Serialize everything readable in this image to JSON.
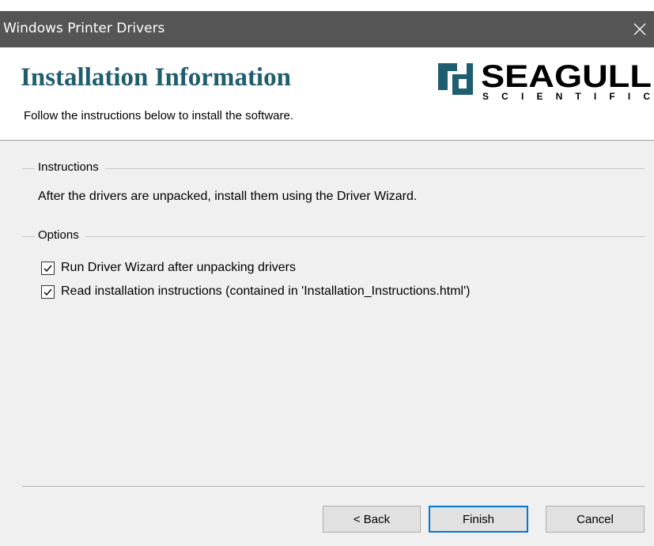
{
  "window": {
    "title": "Windows Printer Drivers",
    "close_icon": "close-icon"
  },
  "header": {
    "title": "Installation Information",
    "subtitle": "Follow the instructions below to install the software.",
    "logo": {
      "brand": "SEAGULL",
      "sub": "SCIENTIFIC",
      "icon": "seagull-logo-mark",
      "colors": {
        "mark": "#1f5d71",
        "text": "#000000"
      }
    }
  },
  "instructions": {
    "group_label": "Instructions",
    "text": "After the drivers are unpacked, install them using the Driver Wizard."
  },
  "options": {
    "group_label": "Options",
    "items": [
      {
        "label": "Run Driver Wizard after unpacking drivers",
        "checked": true
      },
      {
        "label": "Read installation instructions (contained in 'Installation_Instructions.html')",
        "checked": true
      }
    ]
  },
  "buttons": {
    "back": "< Back",
    "finish": "Finish",
    "cancel": "Cancel"
  },
  "colors": {
    "titlebar": "#555555",
    "title_text": "#1f5d71",
    "dialog_bg": "#f0f0f0",
    "default_button_border": "#0078d7"
  }
}
